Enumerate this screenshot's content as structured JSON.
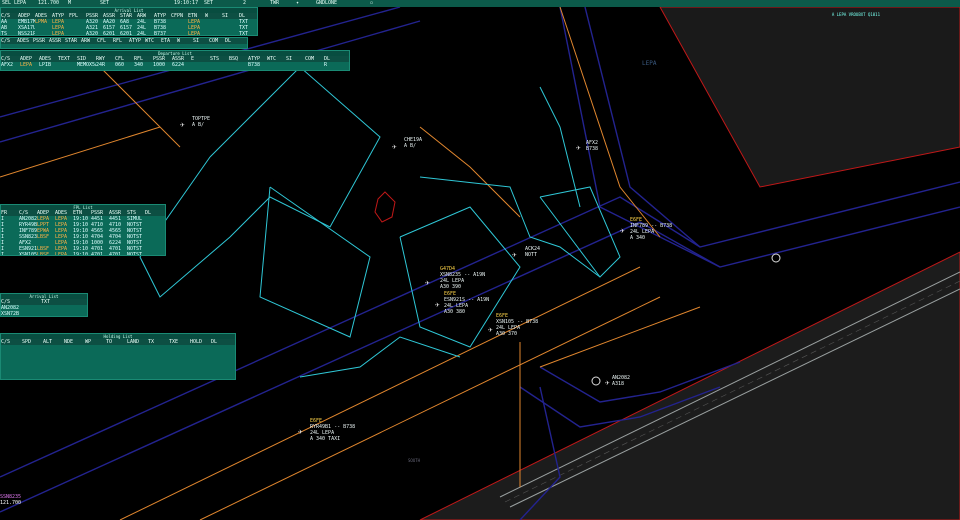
{
  "topbar": {
    "sel": "SEL",
    "aerodrome": "LEPA",
    "freq": "121.700",
    "m": "M",
    "clock": "19:10:17",
    "set1": "SET",
    "set2": "SET",
    "two": "2",
    "tab_map": "TWR",
    "tab_gnd": "GND/DEL",
    "lane": "GNDLONE"
  },
  "panels": {
    "arrivals": {
      "title": "Arrival List",
      "headers": [
        "C/S",
        "ADEP",
        "ADES",
        "ATYP",
        "FPL",
        "PSSR",
        "ASSR",
        "STAR",
        "ARW",
        "ATYP",
        "CFPN",
        "ETN",
        "W",
        "SI",
        "DL"
      ],
      "rows": [
        [
          "AA",
          "EMB17M",
          "LPMA",
          "LEPA",
          "",
          "A320",
          "AA20",
          "6A8",
          "24L",
          "B738",
          "",
          "LEPA",
          "",
          "",
          "TXT"
        ],
        [
          "AB",
          "XSA17U",
          "",
          "LEPA",
          "",
          "A321",
          "6157",
          "6157",
          "24L",
          "B738",
          "",
          "LEPA",
          "",
          "",
          "TXT"
        ],
        [
          "TS",
          "NSS21P",
          "",
          "LEPA",
          "",
          "A320",
          "6201",
          "6201",
          "24L",
          "B737",
          "",
          "LEPA",
          "",
          "",
          "TXT"
        ]
      ]
    },
    "depsubheader": {
      "headers": [
        "C/S",
        "ADES",
        "PSSR",
        "ASSR",
        "STAR",
        "ARW",
        "CFL",
        "RFL",
        "ATYP",
        "WTC",
        "ETA",
        "W",
        "SI",
        "COM",
        "DL"
      ]
    },
    "departures": {
      "title": "Departure List",
      "headers": [
        "C/S",
        "ADEP",
        "ADES",
        "TEXT",
        "SID",
        "RWY",
        "CFL",
        "RFL",
        "PSSR",
        "ASSR",
        "E",
        "STS",
        "BSQ",
        "ATYP",
        "WTC",
        "SI",
        "COM",
        "DL"
      ],
      "rows": [
        [
          "AFX2",
          "LEPA",
          "LPIB",
          "",
          "MEMOX5A",
          "24R",
          "060",
          "340",
          "1000",
          "6224",
          "",
          "",
          "",
          "B738",
          "",
          "",
          "",
          "R"
        ]
      ]
    },
    "fpl": {
      "title": "FPL List",
      "headers": [
        "FR",
        "C/S",
        "ADEP",
        "ADES",
        "ETN",
        "PSSR",
        "ASSR",
        "STS",
        "DL"
      ],
      "rows": [
        [
          "I",
          "AN2082",
          "LEPA",
          "LEPA",
          "19:10",
          "4451",
          "4451",
          "SIMUL",
          ""
        ],
        [
          "I",
          "RYR49B1",
          "LPPT",
          "LEPA",
          "19:10",
          "4710",
          "4710",
          "NOTST",
          ""
        ],
        [
          "I",
          "INF789",
          "EPWA",
          "LEPA",
          "19:10",
          "4565",
          "4565",
          "NOTST",
          ""
        ],
        [
          "I",
          "SSN8235",
          "LBSF",
          "LEPA",
          "19:10",
          "4704",
          "4704",
          "NOTST",
          ""
        ],
        [
          "I",
          "AFX2",
          "",
          "LEPA",
          "19:10",
          "1000",
          "6224",
          "NOTST",
          ""
        ],
        [
          "I",
          "ESN921S",
          "LBSF",
          "LEPA",
          "19:10",
          "4701",
          "4701",
          "NOTST",
          ""
        ],
        [
          "I",
          "XSN105",
          "LBSF",
          "LEPA",
          "19:10",
          "4701",
          "4701",
          "NOTST",
          ""
        ]
      ]
    },
    "arrived": {
      "title": "Arrival List",
      "headers": [
        "C/S",
        "TXT"
      ],
      "rows": [
        [
          "AN2082",
          ""
        ],
        [
          "XSN72B",
          ""
        ]
      ]
    },
    "holding": {
      "title": "Holding List",
      "headers": [
        "C/S",
        "SPD",
        "ALT",
        "NDE",
        "WP",
        "TO",
        "LAND",
        "TX",
        "TXE",
        "HOLD",
        "DL"
      ],
      "rows": []
    },
    "status": {
      "lines": [
        "A LEPA VROUBXT Q1011"
      ]
    }
  },
  "labels": {
    "lepa_area": "LEPA",
    "south": "SOUTH"
  },
  "tracks": [
    {
      "id": "t1",
      "lines": [
        "TOPTPE",
        "A B/"
      ],
      "callsign": ""
    },
    {
      "id": "t2",
      "lines": [
        "CHE19A",
        "A B/"
      ],
      "callsign": ""
    },
    {
      "id": "t3",
      "lines": [
        "AFX2",
        "B738"
      ],
      "callsign": ""
    },
    {
      "id": "t4",
      "lines": [
        "INF789 -- B738",
        "24L LEPA",
        "A 340"
      ],
      "callsign": "E6FE",
      "rw": "LEPA"
    },
    {
      "id": "t5",
      "lines": [
        "XSN8235 -- A19N",
        "24L LEPA",
        "A30 390"
      ],
      "callsign": "G47D4",
      "rw": "LEPA"
    },
    {
      "id": "t6",
      "lines": [
        "ESN921S -- A19N",
        "24L LEPA",
        "A30 380"
      ],
      "callsign": "E6FE",
      "rw": "LEPA"
    },
    {
      "id": "t7",
      "lines": [
        "XSN105 -- B738",
        "24L LEPA",
        "A30 370"
      ],
      "callsign": "E6FE",
      "rw": "LEPA"
    },
    {
      "id": "t8",
      "lines": [
        "RYR49B1 -- B738",
        "24L LEPA",
        "A 340  TAXI"
      ],
      "callsign": "E6FE",
      "rw": "LEPA"
    },
    {
      "id": "t9",
      "lines": [
        "AN2082",
        "A318"
      ],
      "callsign": ""
    },
    {
      "id": "t10",
      "lines": [
        "ACK24",
        "NOTT"
      ],
      "callsign": ""
    }
  ],
  "corner": {
    "lines": [
      "SSN8235",
      "",
      "121.700"
    ]
  },
  "colors": {
    "panel_bg": "#0b6a58",
    "taxiway_cyan": "#2fc7d6",
    "taxiway_orange": "#e0862e",
    "airspace_blue": "#23238f",
    "border_red": "#c01818",
    "runway_white": "#9aa0a0"
  },
  "icons": {
    "aircraft": "aircraft-icon",
    "holding_point": "holding-point-icon",
    "stand": "stand-icon"
  }
}
